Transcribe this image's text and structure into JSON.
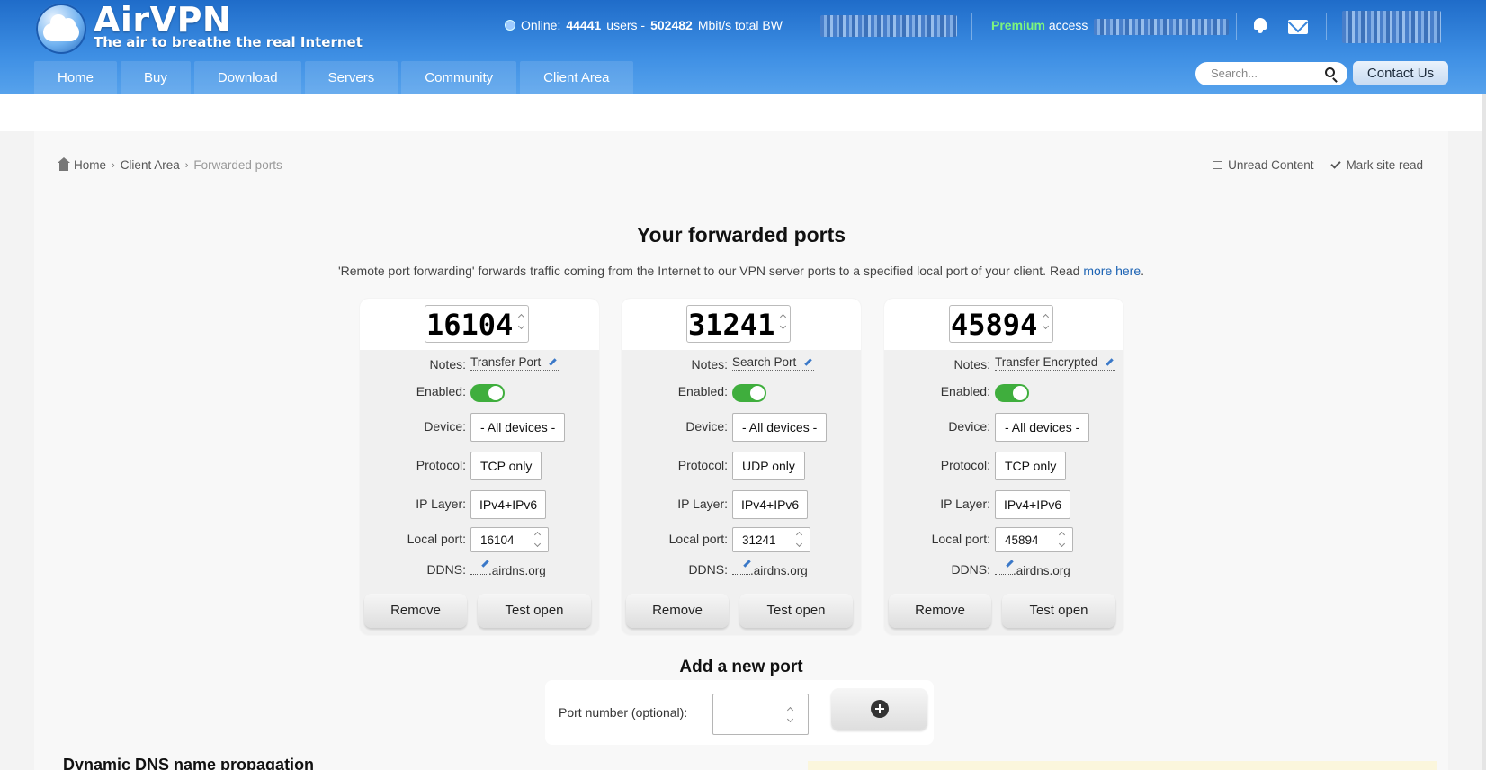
{
  "header": {
    "brand": "AirVPN",
    "tagline": "The air to breathe the real Internet",
    "online_label": "Online:",
    "users_count": "44441",
    "users_label": "users -",
    "bandwidth": "502482",
    "bandwidth_label": "Mbit/s total BW",
    "premium_label": "Premium",
    "access_label": "access",
    "nav": [
      "Home",
      "Buy",
      "Download",
      "Servers",
      "Community",
      "Client Area"
    ],
    "search_placeholder": "Search...",
    "contact_label": "Contact Us"
  },
  "breadcrumb": [
    "Home",
    "Client Area",
    "Forwarded ports"
  ],
  "top_links": {
    "unread": "Unread Content",
    "mark_read": "Mark site read"
  },
  "main": {
    "title": "Your forwarded ports",
    "description": "'Remote port forwarding' forwards traffic coming from the Internet to our VPN server ports to a specified local port of your client. Read ",
    "more_link": "more here",
    "description_end": "."
  },
  "labels": {
    "notes": "Notes:",
    "enabled": "Enabled:",
    "device": "Device:",
    "protocol": "Protocol:",
    "ip_layer": "IP Layer:",
    "local_port": "Local port:",
    "ddns": "DDNS:",
    "remove": "Remove",
    "test": "Test open"
  },
  "ports": [
    {
      "port": "16104",
      "notes": "Transfer Port",
      "enabled": true,
      "device": "- All devices -",
      "protocol": "TCP only",
      "ip_layer": "IPv4+IPv6",
      "local_port": "16104",
      "ddns_suffix": ".airdns.org"
    },
    {
      "port": "31241",
      "notes": "Search Port",
      "enabled": true,
      "device": "- All devices -",
      "protocol": "UDP only",
      "ip_layer": "IPv4+IPv6",
      "local_port": "31241",
      "ddns_suffix": ".airdns.org"
    },
    {
      "port": "45894",
      "notes": "Transfer Encrypted",
      "enabled": true,
      "device": "- All devices -",
      "protocol": "TCP only",
      "ip_layer": "IPv4+IPv6",
      "local_port": "45894",
      "ddns_suffix": ".airdns.org"
    }
  ],
  "add_port": {
    "title": "Add a new port",
    "label": "Port number (optional):",
    "value": ""
  },
  "ddns_section_title": "Dynamic DNS name propagation",
  "colors": {
    "brand_blue": "#2a78d6",
    "toggle_green": "#3fae3d",
    "premium_green": "#7df57d",
    "link": "#1b62b3"
  }
}
